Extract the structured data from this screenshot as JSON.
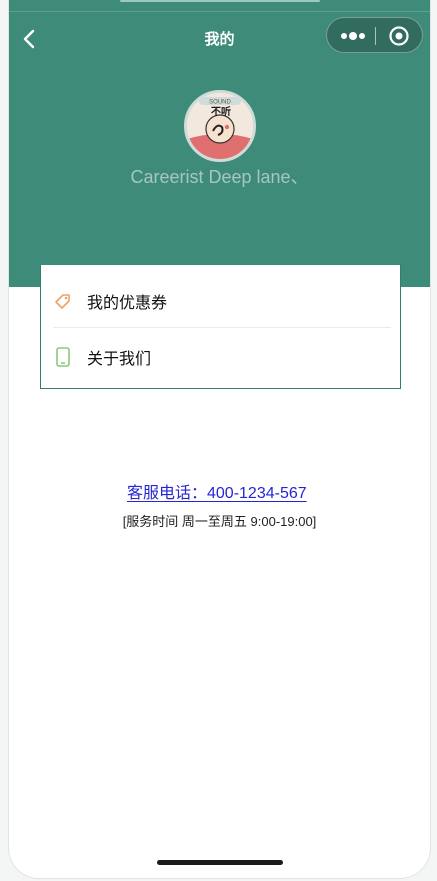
{
  "nav": {
    "title": "我的",
    "back_icon": "chevron-left-icon",
    "capsule": {
      "more_icon": "more-dots-icon",
      "close_icon": "target-circle-icon"
    }
  },
  "profile": {
    "username": "Careerist Deep lane、",
    "avatar_text_top": "不听",
    "avatar_text_badge": "SOUND"
  },
  "menu": {
    "items": [
      {
        "label": "我的优惠券",
        "icon": "coupon-tag-icon",
        "icon_color": "#f0a060"
      },
      {
        "label": "关于我们",
        "icon": "phone-device-icon",
        "icon_color": "#8cc97a"
      }
    ]
  },
  "service": {
    "phone_label": "客服电话：400-1234-567",
    "hours": "[服务时间 周一至周五 9:00-19:00]"
  },
  "colors": {
    "header": "#3f8b79",
    "link": "#2525d6",
    "card_border": "#2f7f6b"
  }
}
